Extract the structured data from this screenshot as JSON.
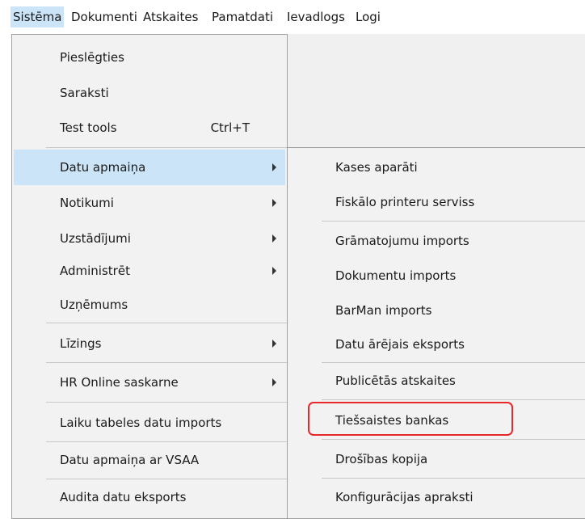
{
  "menubar": {
    "items": [
      "Sistēma",
      "Dokumenti",
      "Atskaites",
      "Pamatdati",
      "Ievadlogs",
      "Logi"
    ]
  },
  "system_menu": {
    "items": [
      {
        "label": "Pieslēgties"
      },
      {
        "label": "Saraksti"
      },
      {
        "label": "Test tools",
        "shortcut": "Ctrl+T"
      },
      {
        "label": "Datu apmaiņa",
        "submenu": true,
        "highlighted": true
      },
      {
        "label": "Notikumi",
        "submenu": true
      },
      {
        "label": "Uzstādījumi",
        "submenu": true
      },
      {
        "label": "Administrēt",
        "submenu": true
      },
      {
        "label": "Uzņēmums"
      },
      {
        "label": "Līzings",
        "submenu": true
      },
      {
        "label": "HR Online saskarne",
        "submenu": true
      },
      {
        "label": "Laiku tabeles datu imports"
      },
      {
        "label": "Datu apmaiņa ar VSAA"
      },
      {
        "label": "Audita datu eksports"
      }
    ]
  },
  "data_exchange_submenu": {
    "items": [
      {
        "label": "Kases aparāti"
      },
      {
        "label": "Fiskālo printeru serviss"
      },
      {
        "label": "Grāmatojumu imports"
      },
      {
        "label": "Dokumentu imports"
      },
      {
        "label": "BarMan imports"
      },
      {
        "label": "Datu ārējais eksports"
      },
      {
        "label": "Publicētās atskaites"
      },
      {
        "label": "Tiešsaistes bankas",
        "callout": true
      },
      {
        "label": "Drošības kopija"
      },
      {
        "label": "Konfigurācijas apraksti"
      }
    ]
  },
  "colors": {
    "highlight": "#cce4f7",
    "callout": "#e8262b"
  }
}
